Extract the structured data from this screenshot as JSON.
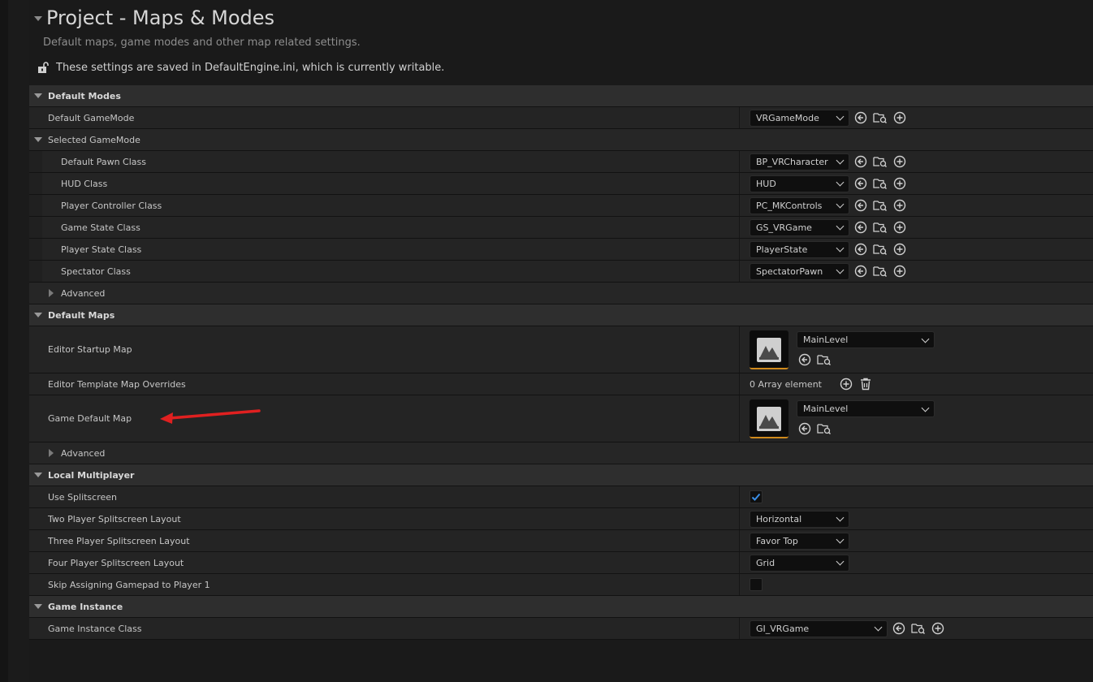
{
  "header": {
    "title": "Project - Maps & Modes",
    "subtitle": "Default maps, game modes and other map related settings.",
    "notice": "These settings are saved in DefaultEngine.ini, which is currently writable."
  },
  "default_modes": {
    "label": "Default Modes",
    "default_gamemode": {
      "label": "Default GameMode",
      "value": "VRGameMode"
    },
    "selected_gamemode": {
      "label": "Selected GameMode",
      "pawn": {
        "label": "Default Pawn Class",
        "value": "BP_VRCharacter"
      },
      "hud": {
        "label": "HUD Class",
        "value": "HUD"
      },
      "controller": {
        "label": "Player Controller Class",
        "value": "PC_MKControls"
      },
      "game_state": {
        "label": "Game State Class",
        "value": "GS_VRGame"
      },
      "player_state": {
        "label": "Player State Class",
        "value": "PlayerState"
      },
      "spectator": {
        "label": "Spectator Class",
        "value": "SpectatorPawn"
      }
    },
    "advanced": "Advanced"
  },
  "default_maps": {
    "label": "Default Maps",
    "editor_startup": {
      "label": "Editor Startup Map",
      "value": "MainLevel"
    },
    "template_overrides": {
      "label": "Editor Template Map Overrides",
      "value": "0 Array element"
    },
    "game_default": {
      "label": "Game Default Map",
      "value": "MainLevel"
    },
    "advanced": "Advanced"
  },
  "local_multiplayer": {
    "label": "Local Multiplayer",
    "use_splitscreen": {
      "label": "Use Splitscreen",
      "checked": true
    },
    "two_player": {
      "label": "Two Player Splitscreen Layout",
      "value": "Horizontal"
    },
    "three_player": {
      "label": "Three Player Splitscreen Layout",
      "value": "Favor Top"
    },
    "four_player": {
      "label": "Four Player Splitscreen Layout",
      "value": "Grid"
    },
    "skip_gamepad": {
      "label": "Skip Assigning Gamepad to Player 1",
      "checked": false
    }
  },
  "game_instance": {
    "label": "Game Instance",
    "class": {
      "label": "Game Instance Class",
      "value": "GI_VRGame"
    }
  },
  "colors": {
    "accent": "#d08a1c",
    "checkbox_check": "#3a8ee6",
    "arrow": "#e02020"
  }
}
